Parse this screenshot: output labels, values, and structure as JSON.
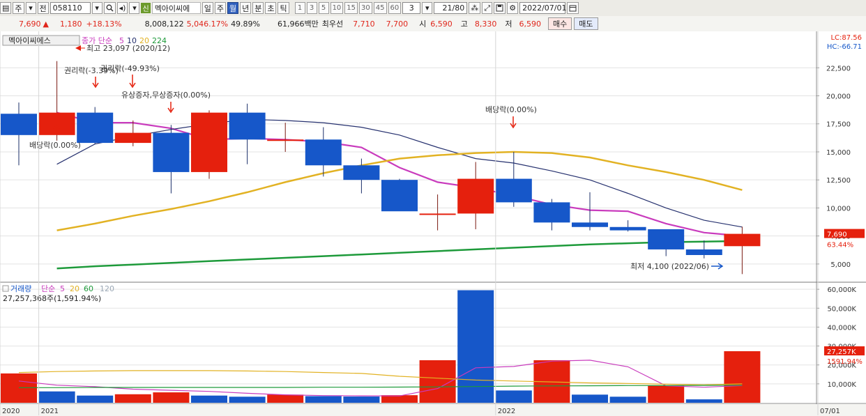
{
  "toolbar": {
    "period_selector": "주",
    "compare_label": "전",
    "code": "058110",
    "name_badge": "신",
    "stock_name": "멕아이씨에",
    "period_buttons": [
      "일",
      "주",
      "월",
      "년",
      "분",
      "초",
      "틱"
    ],
    "active_period": "월",
    "interval_buttons": [
      "1",
      "3",
      "5",
      "10",
      "15",
      "30",
      "45",
      "60"
    ],
    "count_value": "3",
    "range_value": "21/80",
    "date_value": "2022/07/01"
  },
  "quote": {
    "price": "7,690",
    "change_arrow": "▲",
    "change": "1,180",
    "change_pct": "+18.13%",
    "volume": "8,008,122",
    "volume_pct": "5,046.17%",
    "ratio": "49.89%",
    "amount": "61,966백만",
    "best_label": "최우선",
    "best_ask": "7,710",
    "best_bid": "7,700",
    "open_label": "시",
    "open": "6,590",
    "high_label": "고",
    "high": "8,330",
    "low_label": "저",
    "low": "6,590",
    "buy_label": "매수",
    "sell_label": "매도"
  },
  "colors": {
    "up": "#e5200d",
    "down": "#1657c9",
    "ma5": "#c93bbd",
    "ma10": "#25306e",
    "ma20": "#e2b223",
    "ma60": "#1d9a3a",
    "ma120": "#9aa7b5"
  },
  "chart_data": [
    {
      "type": "candlestick",
      "title": "멕아이씨에스",
      "legend_prefix": "종가 단순",
      "legend_periods": [
        "5",
        "10",
        "20",
        "224"
      ],
      "x": [
        "2020-12",
        "2021-01",
        "2021-02",
        "2021-03",
        "2021-04",
        "2021-05",
        "2021-06",
        "2021-07",
        "2021-08",
        "2021-09",
        "2021-10",
        "2021-11",
        "2021-12",
        "2022-01",
        "2022-02",
        "2022-03",
        "2022-04",
        "2022-05",
        "2022-06",
        "2022-07"
      ],
      "open": [
        18400,
        16500,
        18500,
        15800,
        16700,
        13200,
        18500,
        16100,
        16100,
        13800,
        12500,
        9500,
        9500,
        12600,
        10500,
        8700,
        8300,
        8100,
        6300,
        6590
      ],
      "high": [
        19400,
        23097,
        19000,
        17800,
        17400,
        18700,
        19300,
        17600,
        17200,
        14400,
        12600,
        11200,
        14100,
        15000,
        10800,
        11400,
        8900,
        8100,
        7100,
        8330
      ],
      "low": [
        13800,
        16000,
        15700,
        15500,
        11300,
        12600,
        13900,
        15000,
        12800,
        11300,
        9800,
        8000,
        8100,
        10100,
        8000,
        8000,
        7900,
        5700,
        5500,
        4100
      ],
      "close": [
        16500,
        18500,
        15800,
        16700,
        13200,
        18500,
        16100,
        16100,
        13800,
        12500,
        9700,
        9500,
        12600,
        10500,
        8700,
        8300,
        8000,
        6300,
        5800,
        7690
      ],
      "ma_series": [
        {
          "name": "5",
          "values": [
            null,
            18500,
            17600,
            17600,
            17100,
            16100,
            16200,
            16100,
            15900,
            15400,
            13600,
            12300,
            11800,
            11100,
            10300,
            9800,
            9700,
            8600,
            7800,
            7500
          ]
        },
        {
          "name": "10",
          "values": [
            null,
            13900,
            15700,
            16400,
            17000,
            17500,
            17900,
            17800,
            17600,
            17200,
            16500,
            15400,
            14400,
            14000,
            13300,
            12500,
            11300,
            10000,
            8900,
            8300
          ]
        },
        {
          "name": "20",
          "values": [
            null,
            8000,
            8600,
            9300,
            9900,
            10600,
            11400,
            12300,
            13100,
            13800,
            14400,
            14700,
            14900,
            15000,
            14900,
            14500,
            13800,
            13200,
            12500,
            11600
          ]
        },
        {
          "name": "224",
          "values": [
            null,
            4600,
            4800,
            4950,
            5100,
            5250,
            5400,
            5550,
            5700,
            5850,
            6000,
            6150,
            6300,
            6450,
            6600,
            6750,
            6850,
            6950,
            7000,
            7050
          ]
        }
      ],
      "ylim": [
        3500,
        25500
      ],
      "yticks": [
        "5,000",
        "7,500",
        "10,000",
        "12,500",
        "15,000",
        "17,500",
        "20,000",
        "22,500"
      ],
      "xticks": [
        {
          "label": "2020",
          "at": "2020-12"
        },
        {
          "label": "2021",
          "at": "2021-01"
        },
        {
          "label": "2022",
          "at": "2022-01"
        },
        {
          "label": "07/01",
          "at": "2022-07"
        }
      ],
      "last_price_label": "7,690",
      "last_price_pct": "63.44%",
      "corner_top": "LC:87.56",
      "corner_bottom": "HC:-66.71",
      "annotations": {
        "high": "최고 23,097 (2020/12)",
        "low": "최저 4,100 (2022/06)",
        "rights_1": "권리락(-3.39%)",
        "rights_2": "권리락(-49.93%)",
        "capital": "유상증자,무상증자(0.00%)",
        "dividend_1": "배당락(0.00%)",
        "dividend_2": "배당락(0.00%)"
      },
      "grid": true
    },
    {
      "type": "bar",
      "title": "거래량",
      "legend_prefix": "단순",
      "legend_periods": [
        "5",
        "20",
        "60",
        "120"
      ],
      "summary": "27,257,368주(1,591.94%)",
      "x": [
        "2020-12",
        "2021-01",
        "2021-02",
        "2021-03",
        "2021-04",
        "2021-05",
        "2021-06",
        "2021-07",
        "2021-08",
        "2021-09",
        "2021-10",
        "2021-11",
        "2021-12",
        "2022-01",
        "2022-02",
        "2022-03",
        "2022-04",
        "2022-05",
        "2022-06",
        "2022-07"
      ],
      "values": [
        11500,
        15500,
        6000,
        3800,
        4500,
        5500,
        3800,
        3200,
        4300,
        3500,
        3300,
        4000,
        22500,
        59500,
        6500,
        22500,
        4300,
        3200,
        9000,
        1800,
        27257
      ],
      "up": [
        true,
        true,
        false,
        false,
        true,
        true,
        false,
        false,
        true,
        false,
        false,
        true,
        true,
        false,
        false,
        true,
        false,
        false,
        true,
        false,
        true
      ],
      "ma_series": [
        {
          "name": "5",
          "values": [
            null,
            11500,
            9300,
            8500,
            7200,
            6600,
            6000,
            5000,
            4200,
            3800,
            3700,
            3600,
            7500,
            18500,
            19200,
            22000,
            22500,
            19000,
            9000,
            8200,
            9100
          ]
        },
        {
          "name": "20",
          "values": [
            null,
            16000,
            16500,
            16800,
            17000,
            17000,
            17000,
            16800,
            16500,
            16000,
            15500,
            14000,
            13000,
            12000,
            11500,
            11000,
            10500,
            10200,
            9800,
            9500,
            10000
          ]
        },
        {
          "name": "60",
          "values": [
            null,
            8000,
            8000,
            8100,
            8100,
            8100,
            8100,
            8100,
            8100,
            8200,
            8200,
            8300,
            8400,
            8600,
            8800,
            8900,
            9000,
            9100,
            9100,
            9200,
            9300
          ]
        }
      ],
      "ylim": [
        0,
        63000
      ],
      "yticks": [
        "10,000K",
        "20,000K",
        "30,000K",
        "40,000K",
        "50,000K",
        "60,000K"
      ],
      "last_value_label": "27,257K",
      "last_value_pct": "1591.94%",
      "grid": true
    }
  ]
}
